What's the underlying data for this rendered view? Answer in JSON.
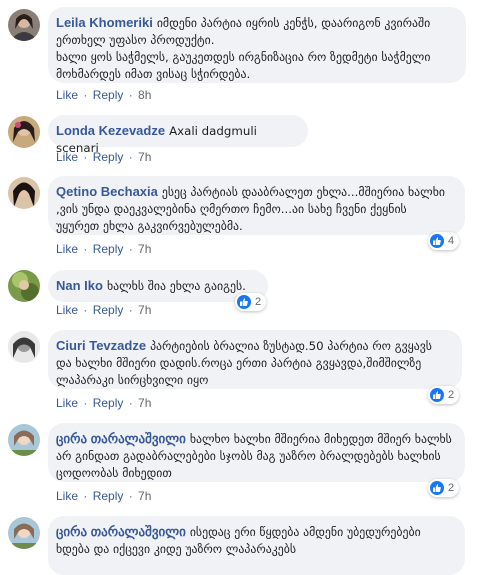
{
  "comments": [
    {
      "author": "Leila Khomeriki",
      "text": "იმდენი პარტია იყრის კენჭს, დაარიგონ კვირაში ერთხელ უფასო პროდუქტი.\nხალი ყოს საჭმელს, გაუკეთდეს ირგნიზაცია რო ზედმეტი საჭმელი მოხმარდეს იმათ ვისაც სჭირდება.",
      "like": "Like",
      "reply": "Reply",
      "time": "8h"
    },
    {
      "author": "Londa Kezevadze",
      "text": "Axali dadgmuli scenari",
      "like": "Like",
      "reply": "Reply",
      "time": "7h"
    },
    {
      "author": "Qetino Bechaxia",
      "text": "ესეც პარტიას დააბრალეთ ეხლა...მშიერია ხალხი ,ვის უნდა დაეკვალებინა ღმერთო ჩემო...აი სახე ჩვენი ქეყნის უყურეთ ეხლა გაკვირვებულებმა.",
      "like": "Like",
      "reply": "Reply",
      "time": "7h",
      "reactions": "4"
    },
    {
      "author": "Nan Iko",
      "text": "ხალხს შია ეხლა გაიგეს.",
      "like": "Like",
      "reply": "Reply",
      "time": "7h",
      "reactions": "2"
    },
    {
      "author": "Ciuri Tevzadze",
      "text": "პარტიების ბრალია ზუსტად.50 პარტია რო გვყავს და ხალხი მშიერი დადის.როცა ერთი პარტია გვყავდა,შიმშილზე ლაპარაკი სირცხვილი იყო",
      "like": "Like",
      "reply": "Reply",
      "time": "7h",
      "reactions": "2"
    },
    {
      "author": "ცირა თარალაშვილი",
      "text": "ხალხო ხალხი მშიერია მიხედეთ მშიერ ხალხს არ გინდათ გადაბრალებები სჯობს მაგ უაზრო ბრალდებებს ხალხის ცოდოობას მიხედით",
      "like": "Like",
      "reply": "Reply",
      "time": "7h",
      "reactions": "2"
    },
    {
      "author": "ცირა თარალაშვილი",
      "text": "ისედაც ერი წყდება ამდენი უბედურებები ხდება და იქცევი კიდე უაზრო ლაპარაკებს"
    }
  ]
}
